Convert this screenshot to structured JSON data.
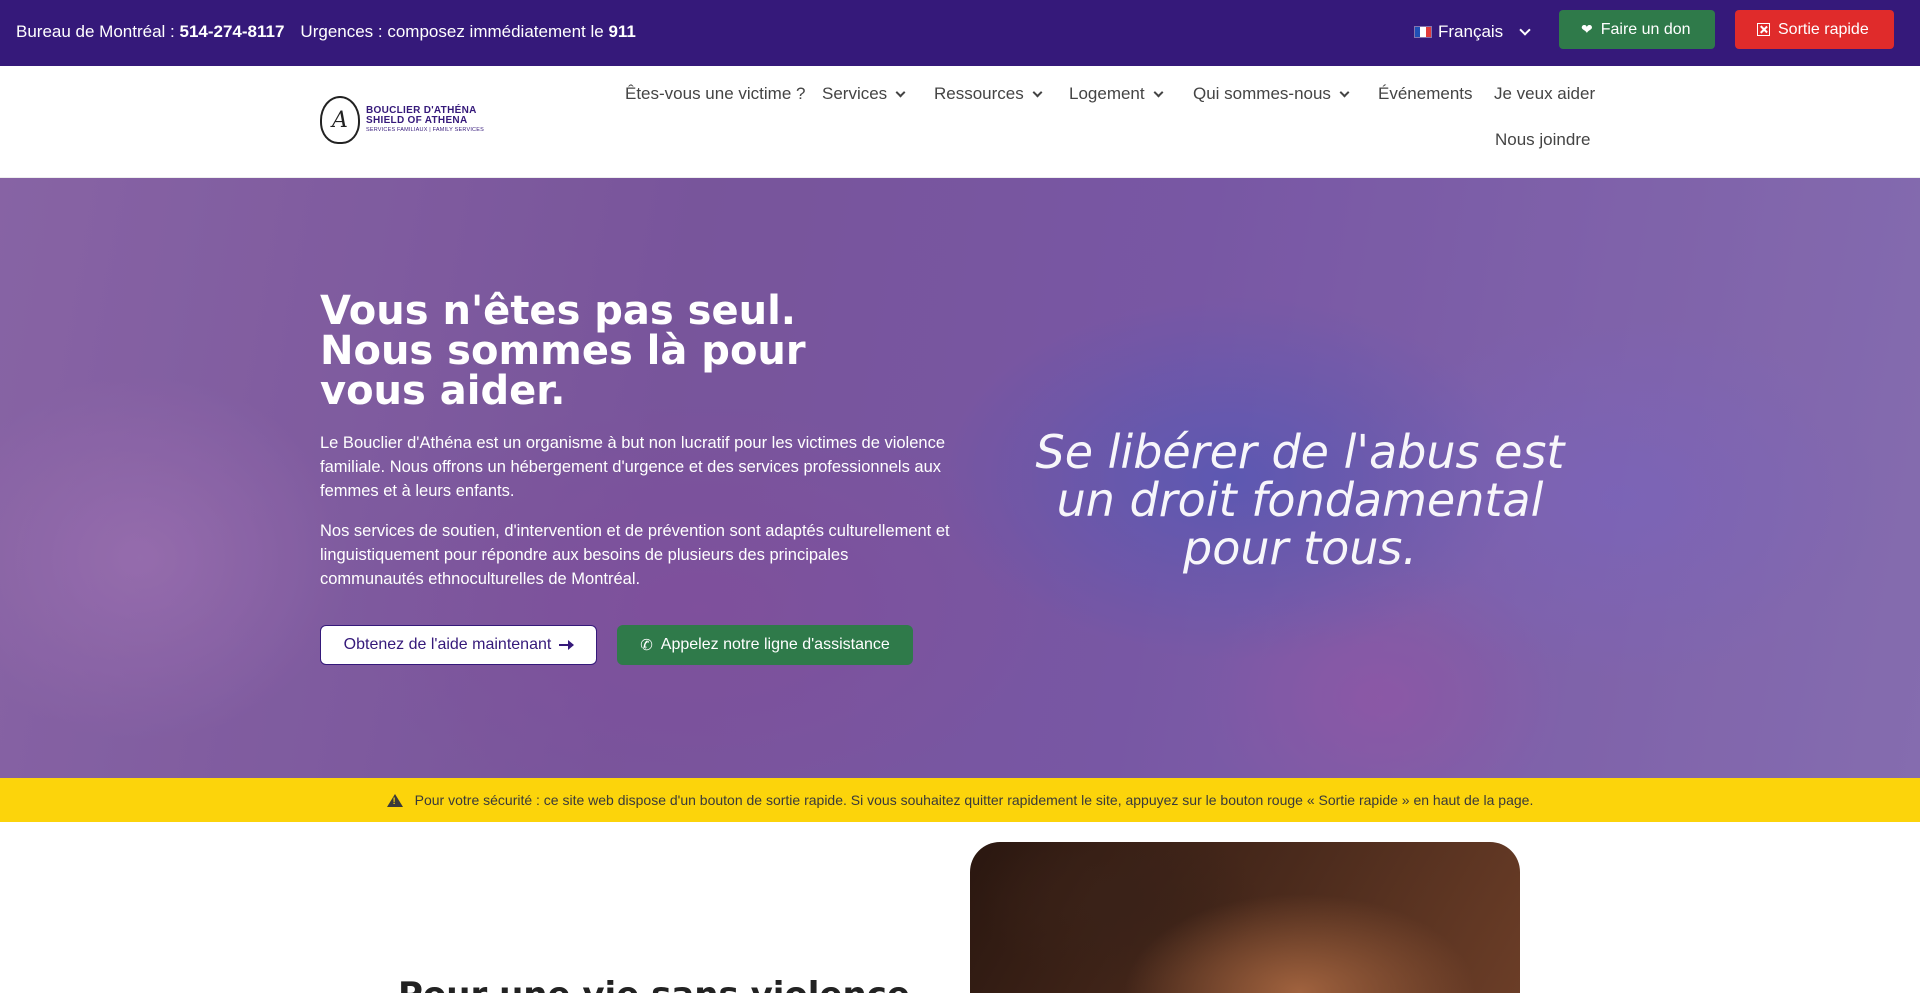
{
  "topbar": {
    "office_label": "Bureau de Montréal : ",
    "office_phone": "514-274-8117",
    "emergency_label": "Urgences : composez immédiatement le ",
    "emergency_number": "911",
    "language": "Français",
    "donate_label": "Faire un don",
    "exit_label": "Sortie rapide",
    "colors": {
      "bar": "#35197a",
      "donate": "#2f7a4a",
      "exit": "#e02b2b"
    }
  },
  "logo": {
    "line1": "BOUCLIER D'ATHÉNA",
    "line2": "SHIELD OF ATHENA",
    "line3": "SERVICES FAMILIAUX | FAMILY SERVICES",
    "mark": "A"
  },
  "nav": {
    "items": [
      {
        "label": "Êtes-vous une victime ?"
      },
      {
        "label": "Services"
      },
      {
        "label": "Ressources"
      },
      {
        "label": "Logement"
      },
      {
        "label": "Qui sommes-nous"
      },
      {
        "label": "Événements"
      },
      {
        "label": "Je veux aider"
      },
      {
        "label": "Nous joindre"
      }
    ]
  },
  "hero": {
    "title_line1": "Vous n'êtes pas seul.",
    "title_line2": "Nous sommes là pour vous aider.",
    "paragraph1": "Le Bouclier d'Athéna est un organisme à but non lucratif pour les victimes de violence familiale. Nous offrons un hébergement d'urgence et des services professionnels aux femmes et à leurs enfants.",
    "paragraph2": "Nos services de soutien, d'intervention et de prévention sont adaptés culturellement et linguistiquement pour répondre aux besoins de plusieurs des principales communautés ethnoculturelles de Montréal.",
    "quote": "Se libérer de l'abus est un droit fondamental pour tous.",
    "help_button": "Obtenez de l'aide maintenant",
    "call_button": "Appelez notre ligne d'assistance"
  },
  "warning": {
    "text": "Pour votre sécurité : ce site web dispose d'un bouton de sortie rapide. Si vous souhaitez quitter rapidement le site, appuyez sur le bouton rouge « Sortie rapide » en haut de la page.",
    "color": "#fcd40b"
  },
  "below": {
    "title": "Pour une vie sans violence"
  }
}
